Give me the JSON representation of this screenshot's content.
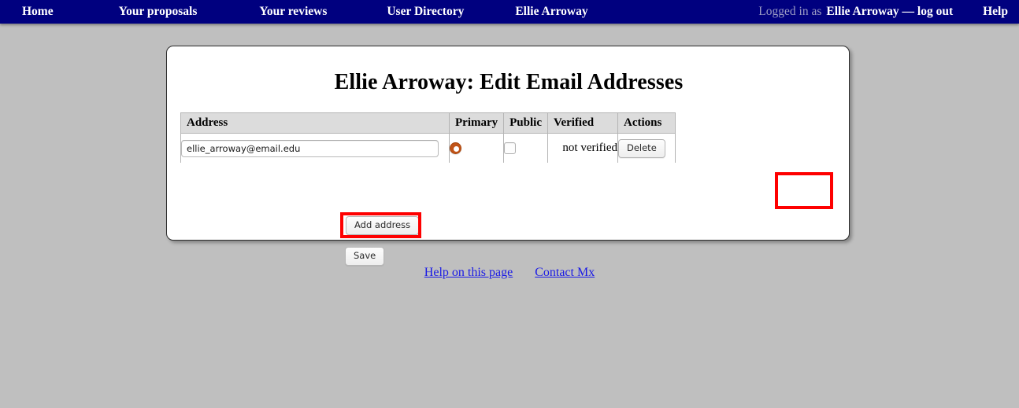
{
  "navbar": {
    "background_color": "#00007f",
    "items": [
      {
        "label": "Home"
      },
      {
        "label": "Your proposals"
      },
      {
        "label": "Your reviews"
      },
      {
        "label": "User Directory"
      },
      {
        "label": "Ellie Arroway"
      }
    ],
    "logged_in_prefix": "Logged in as",
    "logged_in_user": "Ellie Arroway — log out",
    "help_label": "Help"
  },
  "page": {
    "title": "Ellie Arroway: Edit Email Addresses"
  },
  "table": {
    "headers": {
      "address": "Address",
      "primary": "Primary",
      "public": "Public",
      "verified": "Verified",
      "actions": "Actions"
    },
    "rows": [
      {
        "address_value": "ellie_arroway@email.edu",
        "address_placeholder": "",
        "primary_selected": true,
        "public_checked": false,
        "verified_text": "not verified",
        "action_label": "Delete"
      }
    ]
  },
  "buttons": {
    "add_address": "Add address",
    "save": "Save"
  },
  "highlights": {
    "color": "#fe0000",
    "targets": [
      "delete-button",
      "add-address-button"
    ]
  },
  "footer": {
    "help_link": "Help on this page",
    "contact_link": "Contact Mx"
  }
}
